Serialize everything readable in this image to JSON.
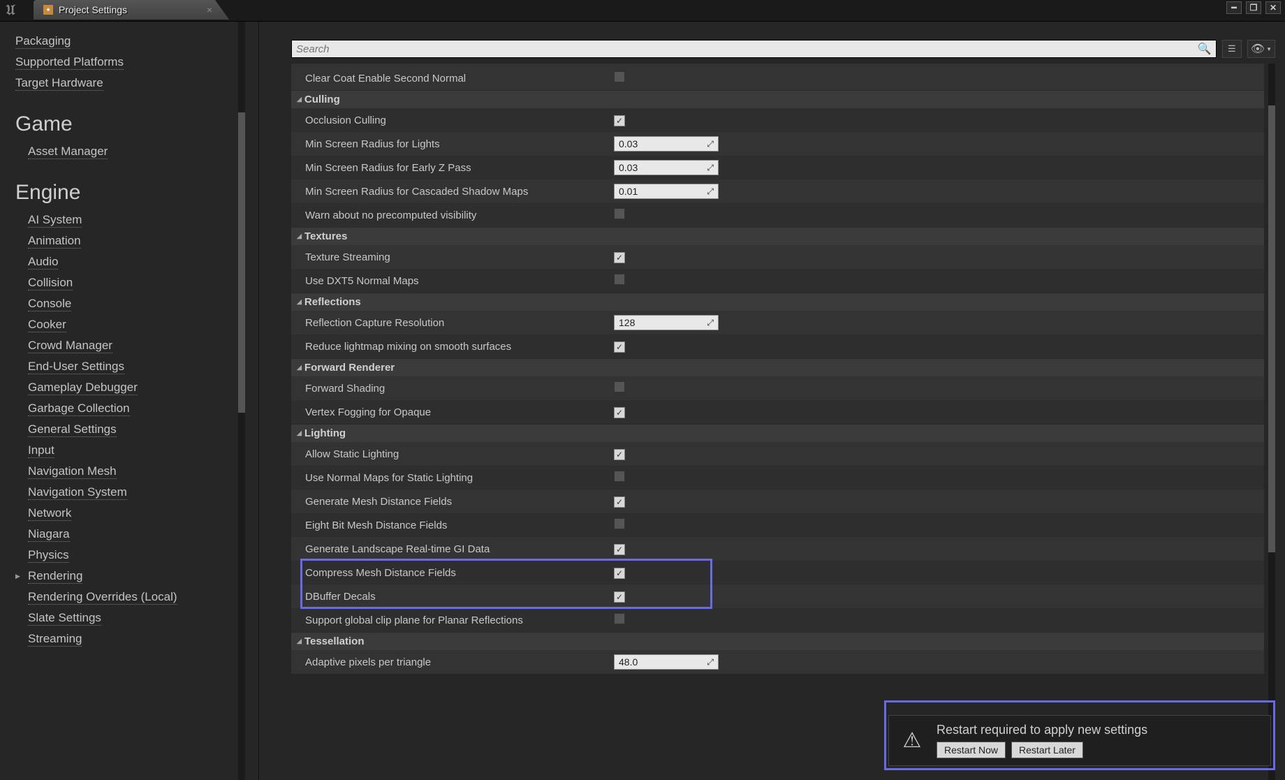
{
  "tab": {
    "title": "Project Settings"
  },
  "search": {
    "placeholder": "Search"
  },
  "sidebar": {
    "top_items": [
      "Packaging",
      "Supported Platforms",
      "Target Hardware"
    ],
    "categories": [
      {
        "title": "Game",
        "items": [
          "Asset Manager"
        ]
      },
      {
        "title": "Engine",
        "items": [
          "AI System",
          "Animation",
          "Audio",
          "Collision",
          "Console",
          "Cooker",
          "Crowd Manager",
          "End-User Settings",
          "Gameplay Debugger",
          "Garbage Collection",
          "General Settings",
          "Input",
          "Navigation Mesh",
          "Navigation System",
          "Network",
          "Niagara",
          "Physics",
          "Rendering",
          "Rendering Overrides (Local)",
          "Slate Settings",
          "Streaming"
        ],
        "active": "Rendering"
      }
    ]
  },
  "sections": [
    {
      "header": null,
      "rows": [
        {
          "label": "Clear Coat Enable Second Normal",
          "type": "check",
          "value": false
        }
      ]
    },
    {
      "header": "Culling",
      "rows": [
        {
          "label": "Occlusion Culling",
          "type": "check",
          "value": true
        },
        {
          "label": "Min Screen Radius for Lights",
          "type": "num",
          "value": "0.03"
        },
        {
          "label": "Min Screen Radius for Early Z Pass",
          "type": "num",
          "value": "0.03"
        },
        {
          "label": "Min Screen Radius for Cascaded Shadow Maps",
          "type": "num",
          "value": "0.01"
        },
        {
          "label": "Warn about no precomputed visibility",
          "type": "check",
          "value": false
        }
      ]
    },
    {
      "header": "Textures",
      "rows": [
        {
          "label": "Texture Streaming",
          "type": "check",
          "value": true
        },
        {
          "label": "Use DXT5 Normal Maps",
          "type": "check",
          "value": false
        }
      ]
    },
    {
      "header": "Reflections",
      "rows": [
        {
          "label": "Reflection Capture Resolution",
          "type": "num",
          "value": "128"
        },
        {
          "label": "Reduce lightmap mixing on smooth surfaces",
          "type": "check",
          "value": true
        }
      ]
    },
    {
      "header": "Forward Renderer",
      "rows": [
        {
          "label": "Forward Shading",
          "type": "check",
          "value": false
        },
        {
          "label": "Vertex Fogging for Opaque",
          "type": "check",
          "value": true
        }
      ]
    },
    {
      "header": "Lighting",
      "rows": [
        {
          "label": "Allow Static Lighting",
          "type": "check",
          "value": true
        },
        {
          "label": "Use Normal Maps for Static Lighting",
          "type": "check",
          "value": false
        },
        {
          "label": "Generate Mesh Distance Fields",
          "type": "check",
          "value": true
        },
        {
          "label": "Eight Bit Mesh Distance Fields",
          "type": "check",
          "value": false
        },
        {
          "label": "Generate Landscape Real-time GI Data",
          "type": "check",
          "value": true
        },
        {
          "label": "Compress Mesh Distance Fields",
          "type": "check",
          "value": true
        },
        {
          "label": "DBuffer Decals",
          "type": "check",
          "value": true
        },
        {
          "label": "Support global clip plane for Planar Reflections",
          "type": "check",
          "value": false
        }
      ]
    },
    {
      "header": "Tessellation",
      "rows": [
        {
          "label": "Adaptive pixels per triangle",
          "type": "num",
          "value": "48.0"
        }
      ]
    }
  ],
  "notification": {
    "title": "Restart required to apply new settings",
    "btn_now": "Restart Now",
    "btn_later": "Restart Later"
  }
}
